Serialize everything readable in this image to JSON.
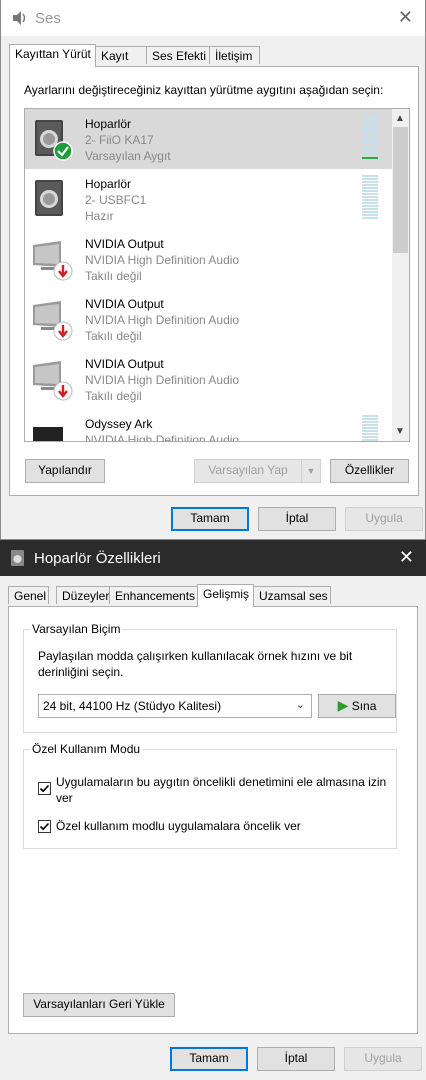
{
  "sound_dialog": {
    "title": "Ses",
    "tabs": [
      "Kayıttan Yürüt",
      "Kayıt",
      "Ses Efekti",
      "İletişim"
    ],
    "instruction": "Ayarlarını değiştireceğiniz kayıttan yürütme aygıtını aşağıdan seçin:",
    "devices": [
      {
        "name": "Hoparlör",
        "sub": "2- FiiO KA17",
        "status": "Varsayılan Aygıt",
        "icon": "speaker-icon",
        "state": "default",
        "level": 0.1
      },
      {
        "name": "Hoparlör",
        "sub": "2- USBFC1",
        "status": "Hazır",
        "icon": "speaker-icon",
        "state": "ready",
        "level": 0
      },
      {
        "name": "NVIDIA Output",
        "sub": "NVIDIA High Definition Audio",
        "status": "Takılı değil",
        "icon": "monitor-icon",
        "state": "unplugged"
      },
      {
        "name": "NVIDIA Output",
        "sub": "NVIDIA High Definition Audio",
        "status": "Takılı değil",
        "icon": "monitor-icon",
        "state": "unplugged"
      },
      {
        "name": "NVIDIA Output",
        "sub": "NVIDIA High Definition Audio",
        "status": "Takılı değil",
        "icon": "monitor-icon",
        "state": "unplugged"
      },
      {
        "name": "Odyssey Ark",
        "sub": "NVIDIA High Definition Audio",
        "status": "",
        "icon": "monitor-icon",
        "state": "ready",
        "level": 0
      }
    ],
    "buttons": {
      "configure": "Yapılandır",
      "set_default": "Varsayılan Yap",
      "properties": "Özellikler",
      "ok": "Tamam",
      "cancel": "İptal",
      "apply": "Uygula"
    }
  },
  "properties_dialog": {
    "title": "Hoparlör Özellikleri",
    "tabs": [
      "Genel",
      "Düzeyler",
      "Enhancements",
      "Gelişmiş",
      "Uzamsal ses"
    ],
    "default_format": {
      "label": "Varsayılan Biçim",
      "description": "Paylaşılan modda çalışırken kullanılacak örnek hızını ve bit derinliğini seçin.",
      "selected": "24 bit, 44100 Hz (Stüdyo Kalitesi)",
      "test_button": "Sına"
    },
    "exclusive_mode": {
      "label": "Özel Kullanım Modu",
      "option1": "Uygulamaların bu aygıtın öncelikli denetimini ele almasına izin ver",
      "option1_checked": true,
      "option2": "Özel kullanım modlu uygulamalara öncelik ver",
      "option2_checked": true
    },
    "buttons": {
      "restore": "Varsayılanları Geri Yükle",
      "ok": "Tamam",
      "cancel": "İptal",
      "apply": "Uygula"
    }
  },
  "colors": {
    "accent": "#0078d7",
    "check_green": "#1e9e3a",
    "unplug_red": "#d41f1f",
    "play_green": "#2a9d2a"
  }
}
